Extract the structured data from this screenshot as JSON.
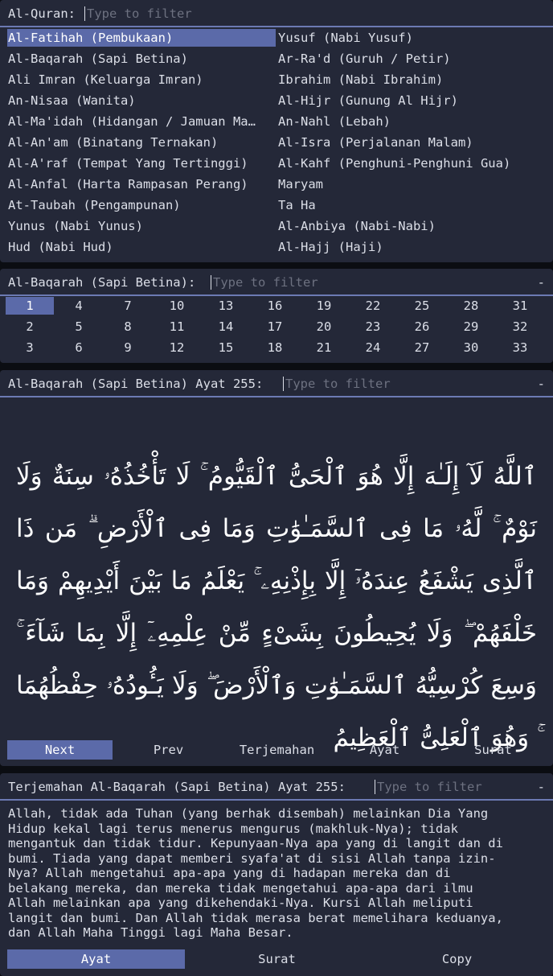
{
  "surah_picker": {
    "label": "Al-Quran:",
    "placeholder": "Type to filter",
    "items": [
      "Al-Fatihah (Pembukaan)",
      "Al-Baqarah (Sapi Betina)",
      "Ali Imran (Keluarga Imran)",
      "An-Nisaa (Wanita)",
      "Al-Ma'idah (Hidangan / Jamuan Ma…",
      "Al-An'am (Binatang Ternakan)",
      "Al-A'raf (Tempat Yang Tertinggi)",
      "Al-Anfal (Harta Rampasan Perang)",
      "At-Taubah (Pengampunan)",
      "Yunus (Nabi Yunus)",
      "Hud (Nabi Hud)",
      "Yusuf (Nabi Yusuf)",
      "Ar-Ra'd (Guruh / Petir)",
      "Ibrahim (Nabi Ibrahim)",
      "Al-Hijr (Gunung Al Hijr)",
      "An-Nahl (Lebah)",
      "Al-Isra (Perjalanan Malam)",
      "Al-Kahf (Penghuni-Penghuni Gua)",
      "Maryam",
      "Ta Ha",
      "Al-Anbiya (Nabi-Nabi)",
      "Al-Hajj (Haji)"
    ],
    "selected_index": 0
  },
  "ayat_picker": {
    "label": "Al-Baqarah (Sapi Betina):",
    "placeholder": "Type to filter",
    "dash": "-",
    "numbers": [
      "1",
      "4",
      "7",
      "10",
      "13",
      "16",
      "19",
      "22",
      "25",
      "28",
      "31",
      "2",
      "5",
      "8",
      "11",
      "14",
      "17",
      "20",
      "23",
      "26",
      "29",
      "32",
      "3",
      "6",
      "9",
      "12",
      "15",
      "18",
      "21",
      "24",
      "27",
      "30",
      "33"
    ],
    "selected": "1"
  },
  "verse": {
    "label": "Al-Baqarah (Sapi Betina) Ayat 255:",
    "placeholder": "Type to filter",
    "dash": "-",
    "arabic": "ٱللَّهُ لَآ إِلَـٰهَ إِلَّا هُوَ ٱلْحَىُّ ٱلْقَيُّومُ ۚ لَا تَأْخُذُهُۥ سِنَةٌ وَلَا نَوْمٌ ۚ لَّهُۥ مَا فِى ٱلسَّمَـٰوَٰتِ وَمَا فِى ٱلْأَرْضِ ۗ مَن ذَا ٱلَّذِى يَشْفَعُ عِندَهُۥٓ إِلَّا بِإِذْنِهِۦ ۚ يَعْلَمُ مَا بَيْنَ أَيْدِيهِمْ وَمَا خَلْفَهُمْ ۖ وَلَا يُحِيطُونَ بِشَىْءٍ مِّنْ عِلْمِهِۦٓ إِلَّا بِمَا شَآءَ ۚ وَسِعَ كُرْسِيُّهُ ٱلسَّمَـٰوَٰتِ وَٱلْأَرْضَ ۖ وَلَا يَـُٔودُهُۥ حِفْظُهُمَا ۚ وَهُوَ ٱلْعَلِىُّ ٱلْعَظِيمُ",
    "buttons": [
      "Next",
      "Prev",
      "Terjemahan",
      "Ayat",
      "Surat"
    ]
  },
  "translation": {
    "label": "Terjemahan Al-Baqarah (Sapi Betina) Ayat 255:",
    "placeholder": "Type to filter",
    "dash": "-",
    "text": "Allah, tidak ada Tuhan (yang berhak disembah) melainkan Dia Yang\nHidup kekal lagi terus menerus mengurus (makhluk-Nya); tidak\nmengantuk dan tidak tidur. Kepunyaan-Nya apa yang di langit dan di\nbumi. Tiada yang dapat memberi syafa'at di sisi Allah tanpa izin-\nNya? Allah mengetahui apa-apa yang di hadapan mereka dan di\nbelakang mereka, dan mereka tidak mengetahui apa-apa dari ilmu\nAllah melainkan apa yang dikehendaki-Nya. Kursi Allah meliputi\nlangit dan bumi. Dan Allah tidak merasa berat memelihara keduanya,\ndan Allah Maha Tinggi lagi Maha Besar.",
    "buttons": [
      "Ayat",
      "Surat",
      "Copy"
    ]
  },
  "colors": {
    "panel_bg": "#242838",
    "selection": "#5b6aa9",
    "separator": "#6c7ab3",
    "placeholder": "#6d7180"
  }
}
